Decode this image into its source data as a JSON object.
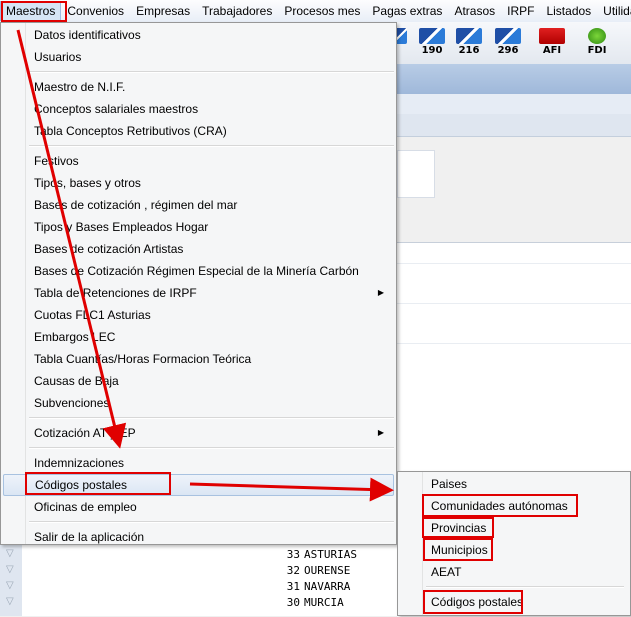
{
  "menubar": {
    "items": [
      "Maestros",
      "Convenios",
      "Empresas",
      "Trabajadores",
      "Procesos mes",
      "Pagas extras",
      "Atrasos",
      "IRPF",
      "Listados",
      "Utilidad"
    ]
  },
  "toolbar": {
    "icons": [
      {
        "label": "190",
        "icon": "tax-model-190-icon"
      },
      {
        "label": "216",
        "icon": "tax-model-216-icon"
      },
      {
        "label": "296",
        "icon": "tax-model-296-icon"
      },
      {
        "label": "AFI",
        "icon": "afi-icon"
      },
      {
        "label": "FDI",
        "icon": "fdi-icon"
      }
    ]
  },
  "menu": {
    "items": [
      "Datos identificativos",
      "Usuarios",
      "Maestro de N.I.F.",
      "Conceptos salariales maestros",
      "Tabla Conceptos Retributivos (CRA)",
      "Festivos",
      "Tipos, bases y otros",
      "Bases de cotización , régimen del mar",
      "Tipos y Bases Empleados Hogar",
      "Bases de cotización Artistas",
      "Bases de Cotización Régimen Especial de la Minería Carbón",
      "Tabla de Retenciones de IRPF",
      "Cuotas FLC1 Asturias",
      "Embargos LEC",
      "Tabla Cuantías/Horas Formacion Teórica",
      "Causas de Baja",
      "Subvenciones",
      "Cotización AT y EP",
      "Indemnizaciones",
      "Códigos postales",
      "Oficinas de empleo",
      "Salir de la aplicación"
    ]
  },
  "submenu": {
    "items": [
      "Paises",
      "Comunidades autónomas",
      "Provincias",
      "Municipios",
      "AEAT",
      "Códigos postales"
    ]
  },
  "table": {
    "rows": [
      {
        "code": "33",
        "name": "ASTURIAS"
      },
      {
        "code": "32",
        "name": "OURENSE"
      },
      {
        "code": "31",
        "name": "NAVARRA"
      },
      {
        "code": "30",
        "name": "MURCIA"
      }
    ]
  },
  "colors": {
    "annotation": "#e00000",
    "highlight": "#dbe6f4",
    "menu_bg": "#f5f6f7"
  }
}
